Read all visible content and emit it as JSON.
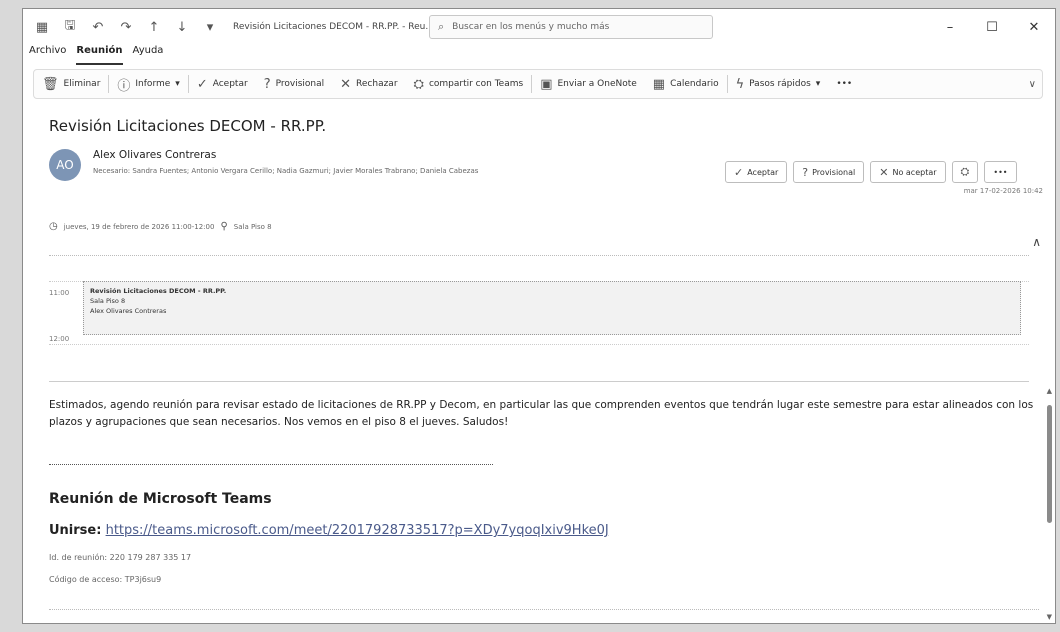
{
  "titlebar": {
    "title": "Revisión Licitaciones DECOM - RR.PP. - Reu...",
    "search_placeholder": "Buscar en los menús y mucho más"
  },
  "menu": {
    "archivo": "Archivo",
    "reunion": "Reunión",
    "ayuda": "Ayuda"
  },
  "ribbon": {
    "eliminar": "Eliminar",
    "informe": "Informe",
    "aceptar": "Aceptar",
    "provisional": "Provisional",
    "rechazar": "Rechazar",
    "compartir": "compartir con Teams",
    "onenote": "Enviar a OneNote",
    "calendario": "Calendario",
    "pasos": "Pasos rápidos",
    "more": "•••"
  },
  "message": {
    "subject": "Revisión Licitaciones DECOM - RR.PP.",
    "avatar_initials": "AO",
    "sender": "Alex Olivares Contreras",
    "attendees": "Necesario:   Sandra Fuentes;   Antonio Vergara Cerillo;   Nadia Gazmuri;   Javier Morales Trabrano;   Daniela Cabezas",
    "sent": "mar 17-02-2026 10:42",
    "datetime": "jueves, 19 de febrero de 2026 11:00-12:00",
    "location": "Sala Piso 8"
  },
  "response": {
    "aceptar": "Aceptar",
    "provisional": "Provisional",
    "no_aceptar": "No aceptar"
  },
  "calendar": {
    "time_start": "11:00",
    "time_end": "12:00",
    "event_title": "Revisión Licitaciones DECOM - RR.PP.",
    "event_location": "Sala Piso 8",
    "event_organizer": "Alex Olivares Contreras"
  },
  "body": {
    "text": "Estimados, agendo reunión para revisar estado de licitaciones de RR.PP y Decom, en particular las que comprenden eventos que tendrán lugar este semestre para estar alineados con los plazos y agrupaciones que sean necesarios. Nos vemos en el piso 8 el jueves. Saludos!",
    "teams_heading": "Reunión de Microsoft Teams",
    "join_label": "Unirse:",
    "join_url": "https://teams.microsoft.com/meet/22017928733517?p=XDy7yqoqIxiv9Hke0J",
    "meeting_id": "Id. de reunión: 220 179 287 335 17",
    "access_code": "Código de acceso: TP3j6su9"
  },
  "colors": {
    "link": "#4a5a8a",
    "avatar": "#7d95b5"
  }
}
